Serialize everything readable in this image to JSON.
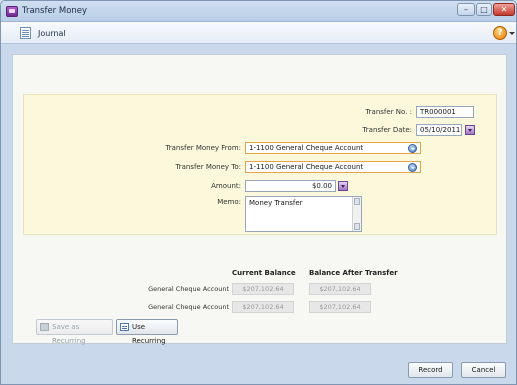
{
  "window": {
    "title": "Transfer Money"
  },
  "toolbar": {
    "journal_label": "Journal"
  },
  "form": {
    "transfer_no_label": "Transfer No. :",
    "transfer_no_value": "TR000001",
    "transfer_date_label": "Transfer Date:",
    "transfer_date_value": "05/10/2011",
    "from_label": "Transfer Money From:",
    "from_value": "1-1100 General Cheque Account",
    "to_label": "Transfer Money To:",
    "to_value": "1-1100 General Cheque Account",
    "amount_label": "Amount:",
    "amount_value": "$0.00",
    "memo_label": "Memo:",
    "memo_value": "Money Transfer"
  },
  "balances": {
    "current_header": "Current Balance",
    "after_header": "Balance After Transfer",
    "rows": [
      {
        "account": "General Cheque Account",
        "current": "$207,102.64",
        "after": "$207,102.64"
      },
      {
        "account": "General Cheque Account",
        "current": "$207,102.64",
        "after": "$207,102.64"
      }
    ]
  },
  "buttons": {
    "save_recurring": "Save as Recurring",
    "use_recurring": "Use Recurring",
    "record": "Record",
    "cancel": "Cancel"
  },
  "icons": {
    "app": "transfer-money-icon",
    "journal": "journal-icon",
    "help": "help-icon",
    "combo": "dropdown-circle-icon",
    "calendar": "calendar-dropdown-icon"
  },
  "colors": {
    "form_background": "#fcf8dc",
    "highlight_border": "#e7a34a",
    "titlebar": "#b8cde6"
  }
}
